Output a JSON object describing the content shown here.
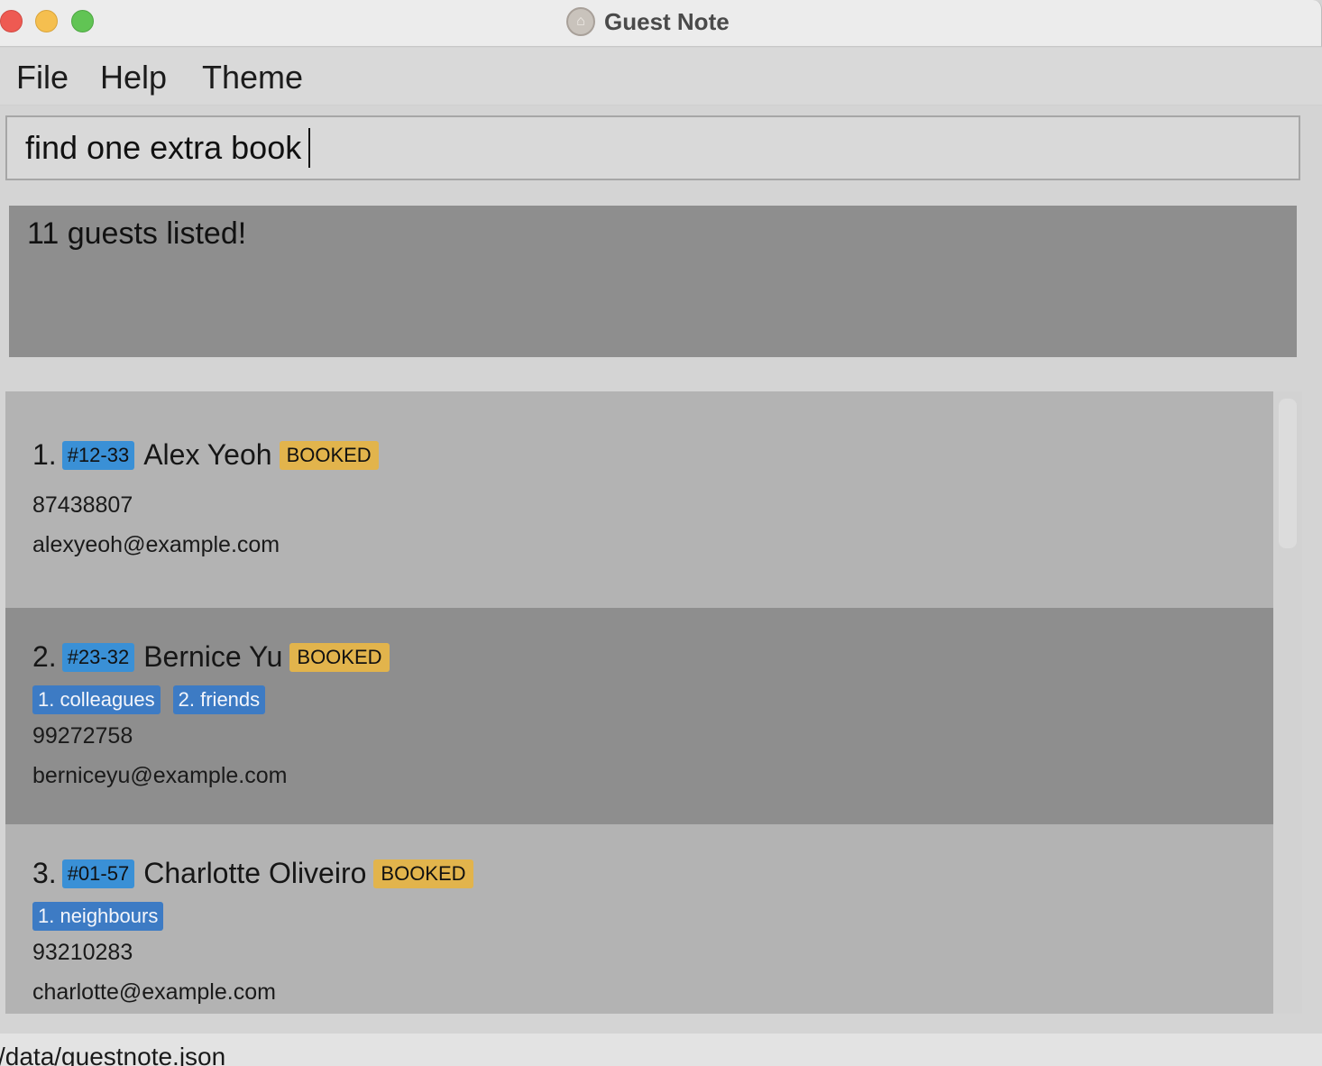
{
  "window": {
    "title": "Guest Note",
    "icon": "house-icon"
  },
  "menu": {
    "file": "File",
    "help": "Help",
    "theme": "Theme"
  },
  "command": {
    "value": "find one extra book"
  },
  "result": {
    "message": "11 guests listed!"
  },
  "guests": [
    {
      "index": "1.",
      "room": "#12-33",
      "name": "Alex Yeoh",
      "status": "BOOKED",
      "tags": [],
      "phone": "87438807",
      "email": "alexyeoh@example.com"
    },
    {
      "index": "2.",
      "room": "#23-32",
      "name": "Bernice Yu",
      "status": "BOOKED",
      "tags": [
        "1. colleagues",
        "2. friends"
      ],
      "phone": "99272758",
      "email": "berniceyu@example.com"
    },
    {
      "index": "3.",
      "room": "#01-57",
      "name": "Charlotte Oliveiro",
      "status": "BOOKED",
      "tags": [
        "1. neighbours"
      ],
      "phone": "93210283",
      "email": "charlotte@example.com"
    }
  ],
  "status_bar": {
    "path": "/data/guestnote.json"
  },
  "colors": {
    "room_tag": "#3a90d6",
    "status_tag": "#e2b44c",
    "group_tag": "#3d7bc4",
    "selected_row": "#8e8e8e",
    "row": "#b3b3b3"
  }
}
